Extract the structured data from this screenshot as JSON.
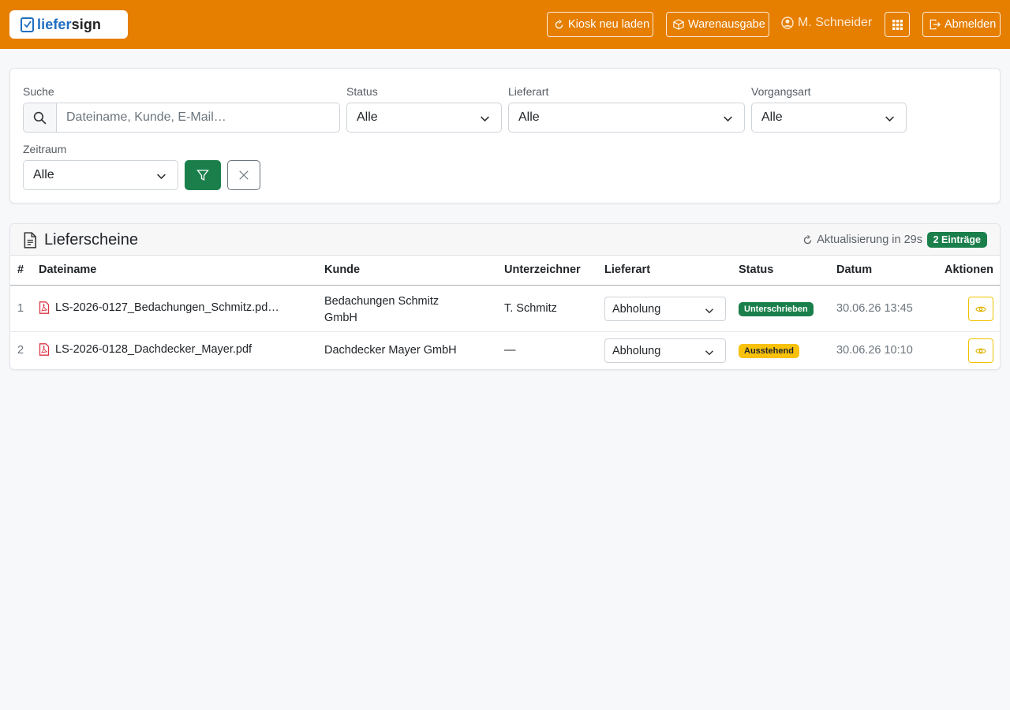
{
  "navbar": {
    "brand_a": "liefer",
    "brand_b": "sign",
    "kiosk_label": "Kiosk neu laden",
    "warenausgabe_label": "Warenausgabe",
    "user_name": "M. Schneider",
    "logout_label": "Abmelden",
    "bg_color": "#e67e00"
  },
  "filters": {
    "search_label": "Suche",
    "search_placeholder": "Dateiname, Kunde, E-Mail…",
    "search_value": "",
    "status_label": "Status",
    "status_value": "Alle",
    "lieferart_label": "Lieferart",
    "lieferart_value": "Alle",
    "vorgangsart_label": "Vorgangsart",
    "vorgangsart_value": "Alle",
    "zeitraum_label": "Zeitraum",
    "zeitraum_value": "Alle"
  },
  "table": {
    "title": "Lieferscheine",
    "refresh_text": "Aktualisierung in 29s",
    "count_badge": "2 Einträge",
    "columns": [
      "#",
      "Dateiname",
      "Kunde",
      "Unterzeichner",
      "Lieferart",
      "Status",
      "Datum",
      "Aktionen"
    ],
    "rows": [
      {
        "num": "1",
        "filename": "LS-2026-0127_Bedachungen_Schmitz.pd…",
        "customer_line1": "Bedachungen Schmitz",
        "customer_line2": "GmbH",
        "signer": "T. Schmitz",
        "lieferart": "Abholung",
        "status": "Unterschrieben",
        "status_color": "#1a7f4b",
        "date": "30.06.26 13:45"
      },
      {
        "num": "2",
        "filename": "LS-2026-0128_Dachdecker_Mayer.pdf",
        "customer_line1": "Dachdecker Mayer GmbH",
        "customer_line2": "",
        "signer": "—",
        "lieferart": "Abholung",
        "status": "Ausstehend",
        "status_color": "#f8c10a",
        "date": "30.06.26 10:10"
      }
    ]
  }
}
